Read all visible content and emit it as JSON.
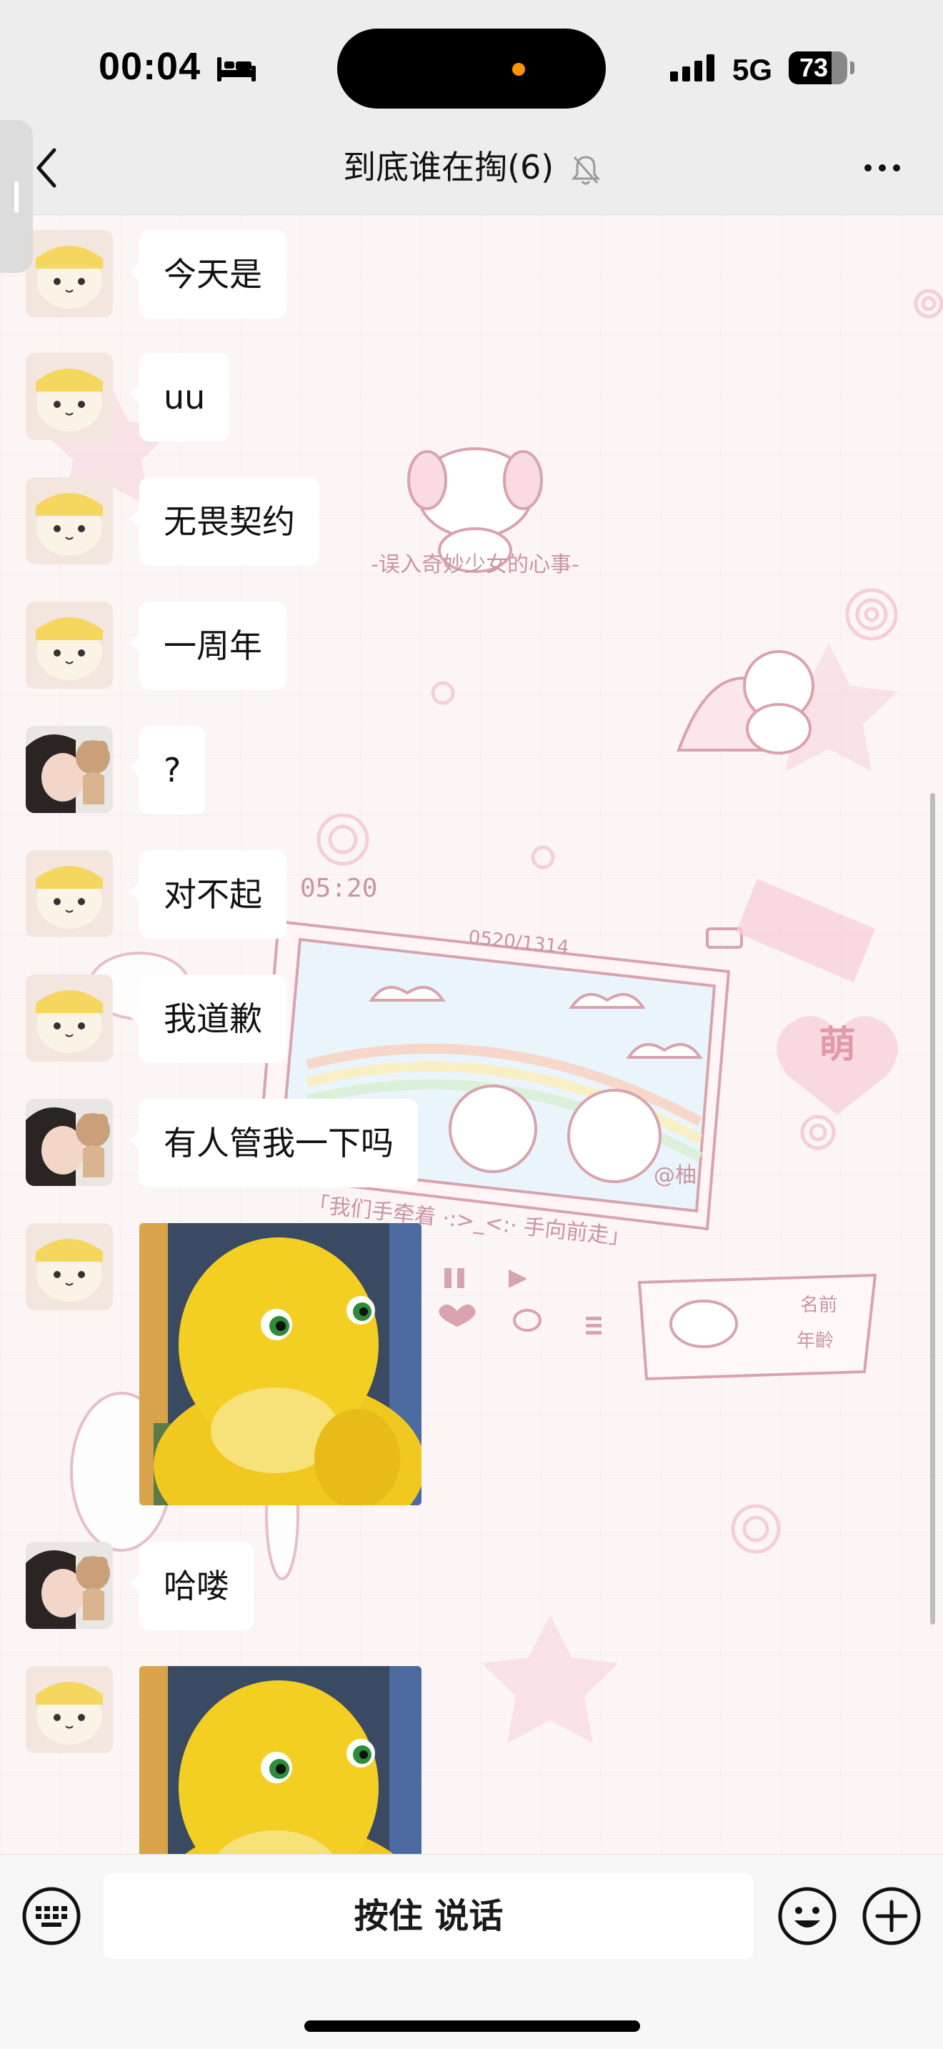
{
  "status_bar": {
    "time": "00:04",
    "network": "5G",
    "battery_level": "73",
    "battery_fraction": 0.73
  },
  "nav": {
    "title": "到底谁在掏(6)"
  },
  "wallpaper": {
    "texts": {
      "caption1": "-误入奇妙少女的心事-",
      "clock": "05:20",
      "date": "0520/1314",
      "handle": "@柚",
      "caption2": "「我们手牵着 ·:>_<:· 手向前走」",
      "moe": "萌",
      "name_label": "名前",
      "age_label": "年齡"
    }
  },
  "messages": [
    {
      "sender": "cat",
      "type": "text",
      "text": "今天是"
    },
    {
      "sender": "cat",
      "type": "text",
      "text": "uu"
    },
    {
      "sender": "cat",
      "type": "text",
      "text": "无畏契约"
    },
    {
      "sender": "cat",
      "type": "text",
      "text": "一周年"
    },
    {
      "sender": "girl",
      "type": "text",
      "text": "?"
    },
    {
      "sender": "cat",
      "type": "text",
      "text": "对不起"
    },
    {
      "sender": "cat",
      "type": "text",
      "text": "我道歉"
    },
    {
      "sender": "girl",
      "type": "text",
      "text": "有人管我一下吗"
    },
    {
      "sender": "cat",
      "type": "image",
      "image": "yellow-duck-sticker"
    },
    {
      "sender": "girl",
      "type": "text",
      "text": "哈喽"
    },
    {
      "sender": "cat",
      "type": "image",
      "image": "yellow-duck-sticker"
    }
  ],
  "input": {
    "voice_label": "按住 说话"
  },
  "colors": {
    "background": "#fcf5f6",
    "bubble": "#ffffff",
    "bar": "#ededed"
  }
}
